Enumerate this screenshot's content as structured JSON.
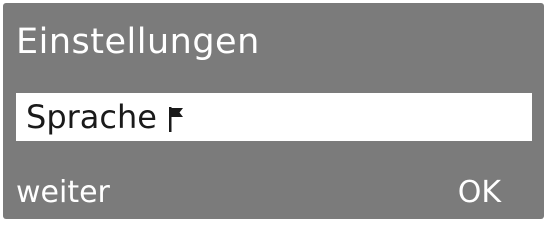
{
  "screen": {
    "title": "Einstellungen",
    "background_color": "#7b7b7b",
    "highlight_color": "#ffffff"
  },
  "menu": {
    "selected_item": {
      "label": "Sprache",
      "icon": "flag-icon"
    }
  },
  "softkeys": {
    "left_label": "weiter",
    "right_label": "OK"
  }
}
